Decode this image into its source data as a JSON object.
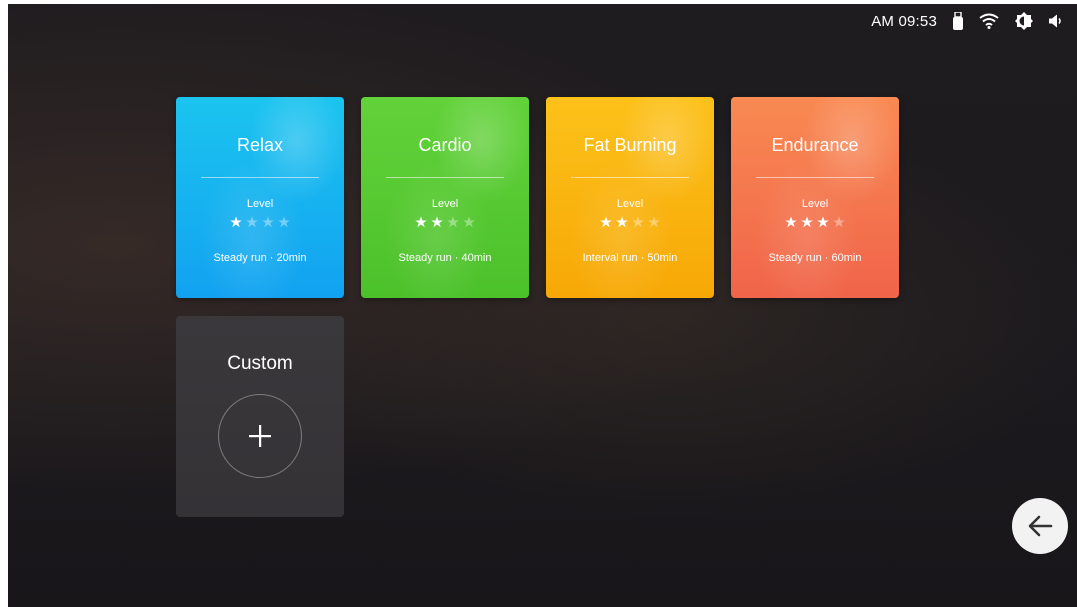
{
  "status_bar": {
    "time": "AM 09:53",
    "icons": [
      "usb-icon",
      "wifi-icon",
      "brightness-icon",
      "volume-icon"
    ]
  },
  "programs": [
    {
      "title": "Relax",
      "level_label": "Level",
      "stars_filled": 1,
      "stars_total": 4,
      "meta": "Steady run · 20min",
      "color_top": "#1bc4ef",
      "color_bottom": "#12a2f0"
    },
    {
      "title": "Cardio",
      "level_label": "Level",
      "stars_filled": 2,
      "stars_total": 4,
      "meta": "Steady run · 40min",
      "color_top": "#63d23a",
      "color_bottom": "#4bc12a"
    },
    {
      "title": "Fat Burning",
      "level_label": "Level",
      "stars_filled": 2,
      "stars_total": 4,
      "meta": "Interval run · 50min",
      "color_top": "#fcc11a",
      "color_bottom": "#f7a806"
    },
    {
      "title": "Endurance",
      "level_label": "Level",
      "stars_filled": 3,
      "stars_total": 4,
      "meta": "Steady run · 60min",
      "color_top": "#f98a52",
      "color_bottom": "#f0644a"
    }
  ],
  "custom": {
    "title": "Custom",
    "icon": "plus-icon"
  },
  "back_button": {
    "icon": "arrow-left-icon"
  }
}
